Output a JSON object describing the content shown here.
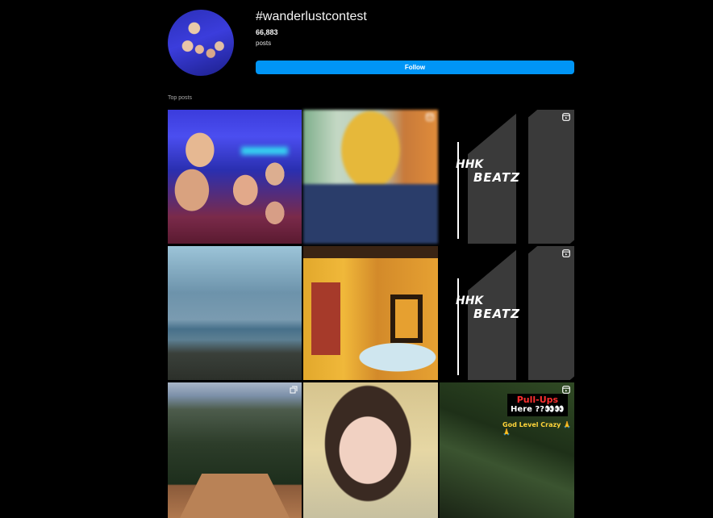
{
  "header": {
    "hashtag": "#wanderlustcontest",
    "post_count": "66,883",
    "posts_label": "posts",
    "follow_label": "Follow"
  },
  "section": {
    "label": "Top posts"
  },
  "posts": [
    {
      "name": "post-selfie",
      "reel": false
    },
    {
      "name": "post-yellow-jacket",
      "reel": true
    },
    {
      "name": "post-hhk-beatz",
      "reel": true,
      "line1": "HHK",
      "line2": "BEATZ"
    },
    {
      "name": "post-beach",
      "reel": false
    },
    {
      "name": "post-yellow-room",
      "reel": false
    },
    {
      "name": "post-hhk-beatz-2",
      "reel": true,
      "line1": "HHK",
      "line2": "BEATZ"
    },
    {
      "name": "post-forest-tower",
      "reel": false
    },
    {
      "name": "post-portrait",
      "reel": false
    },
    {
      "name": "post-pull-ups",
      "reel": true,
      "line1": "Pull-Ups",
      "line2": "Here ??👀👀",
      "line3": "God Level Crazy 🙏🙏"
    }
  ],
  "colors": {
    "accent": "#0095f6",
    "background": "#000000"
  }
}
